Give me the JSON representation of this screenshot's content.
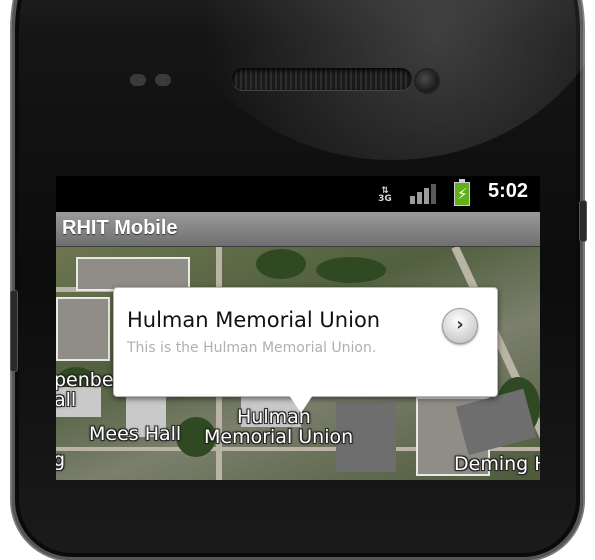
{
  "status_bar": {
    "network": "3G",
    "time": "5:02"
  },
  "app": {
    "title": "RHIT Mobile"
  },
  "popup": {
    "title": "Hulman Memorial Union",
    "description": "This is the Hulman Memorial Union.",
    "action_icon": "chevron-right-icon",
    "action_glyph": "›"
  },
  "map_labels": {
    "left_top": "penber",
    "left_bottom": "all",
    "mees_hall": "Mees Hall",
    "hulman_line1": "Hulman",
    "hulman_line2": "Memorial Union",
    "deming": "Deming H",
    "left_edge": "g"
  },
  "colors": {
    "titlebar": "#7f7f7f",
    "battery": "#5fb01a"
  }
}
